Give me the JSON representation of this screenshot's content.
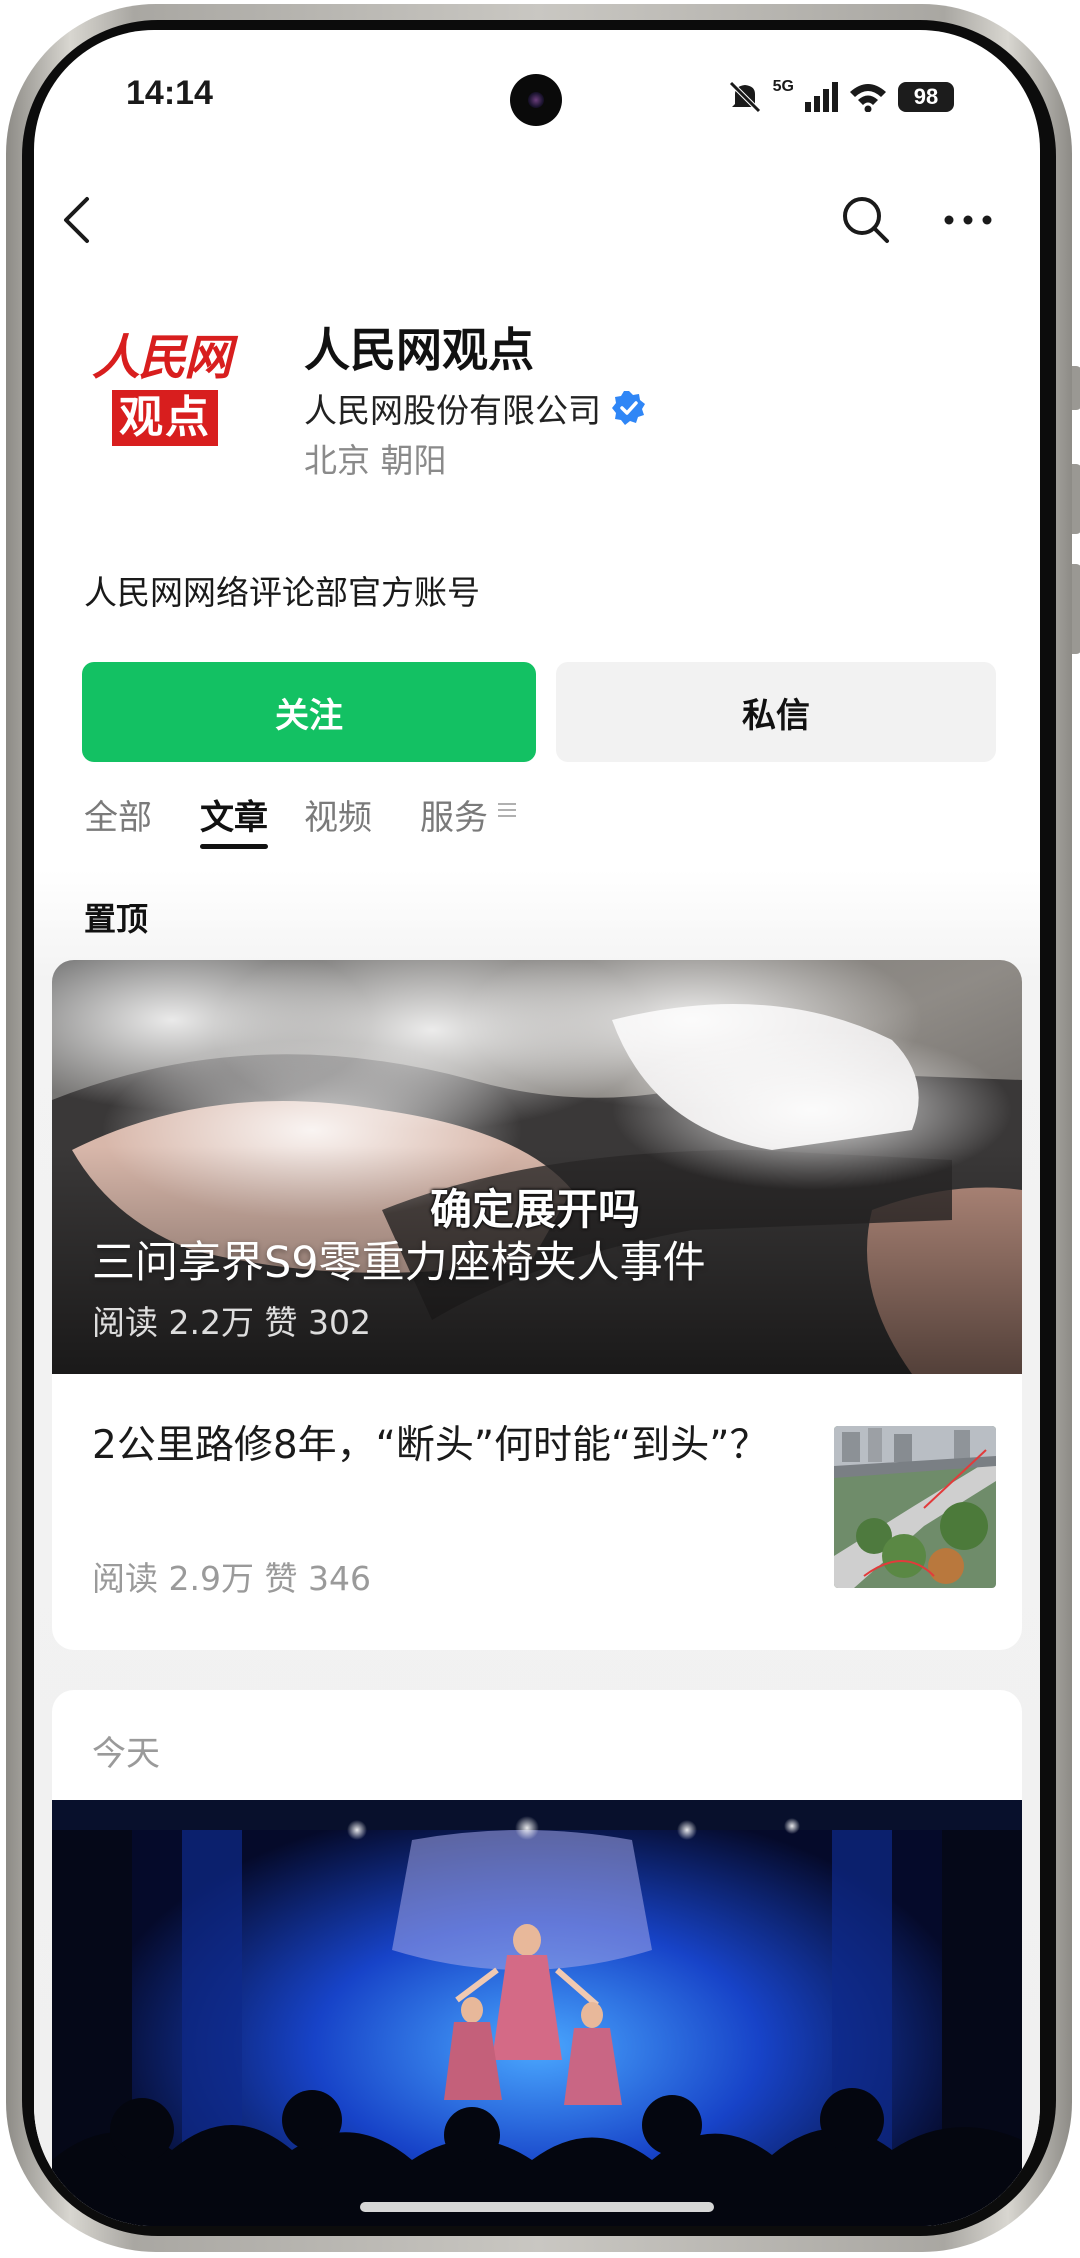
{
  "status_bar": {
    "time": "14:14",
    "network": "5G",
    "battery": "98",
    "icons": [
      "mute-icon",
      "signal-icon",
      "wifi-icon",
      "battery-icon"
    ]
  },
  "top_nav": {
    "back_icon": "chevron-left-icon",
    "search_icon": "search-icon",
    "more_icon": "more-horizontal-icon"
  },
  "profile": {
    "logo_text_top": "人民网",
    "logo_text_bottom": "观点",
    "name": "人民网观点",
    "company": "人民网股份有限公司",
    "verified_icon": "verified-badge-icon",
    "location": "北京 朝阳",
    "description": "人民网网络评论部官方账号",
    "follow_label": "关注",
    "message_label": "私信"
  },
  "tabs": [
    {
      "label": "全部",
      "active": false
    },
    {
      "label": "文章",
      "active": true
    },
    {
      "label": "视频",
      "active": false
    },
    {
      "label": "服务",
      "active": false
    }
  ],
  "pinned": {
    "section_label": "置顶",
    "hero": {
      "caption_overlay": "确定展开吗",
      "title": "三问享界S9零重力座椅夹人事件",
      "stats": "阅读 2.2万  赞 302"
    },
    "article": {
      "title": "2公里路修8年，“断头”何时能“到头”？",
      "stats": "阅读 2.9万  赞 346"
    }
  },
  "today": {
    "section_label": "今天"
  },
  "colors": {
    "accent_green": "#13c163",
    "logo_red": "#d81e1e",
    "verified_blue": "#2f86f6"
  }
}
